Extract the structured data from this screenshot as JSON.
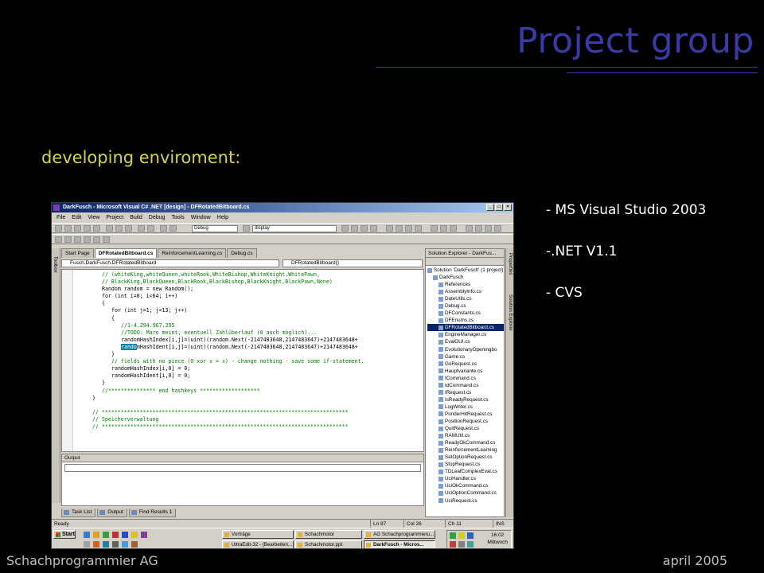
{
  "slide": {
    "title": "Project group",
    "subheading": "developing enviroment:",
    "bullets": [
      "- MS Visual Studio 2003",
      "-.NET V1.1",
      "- CVS"
    ],
    "footer_left": "Schachprogrammier AG",
    "footer_right": "april 2005",
    "colors": {
      "title": "#3a3aa6",
      "subheading": "#d4d44a",
      "background": "#000000"
    }
  },
  "vs": {
    "window_title": "DarkFusch - Microsoft Visual C# .NET [design] - DFRotatedBitboard.cs",
    "window_buttons": [
      "_",
      "□",
      "×"
    ],
    "menu": [
      "File",
      "Edit",
      "View",
      "Project",
      "Build",
      "Debug",
      "Tools",
      "Window",
      "Help"
    ],
    "toolbar": {
      "config": "Debug",
      "find": "display"
    },
    "toolbox_label": "Toolbox",
    "tabs": [
      "Start Page",
      "DFRotatedBitboard.cs",
      "ReinforcementLearning.cs",
      "Debug.cs"
    ],
    "nav": {
      "class_combo": "Fusch.DarkFusch.DFRotatedBitboard",
      "member_combo": "DFRotatedBitboard()"
    },
    "code": [
      {
        "text": "// (whiteKing,whiteQueen,whiteRook,WhiteBishop,WhiteKnight,WhitePawn,",
        "indent": 8,
        "kind": "comment"
      },
      {
        "text": "// BlackKing,BlackQueen,BlackRook,BlackBishop,BlackKnight,BlackPawn,None)",
        "indent": 8,
        "kind": "comment"
      },
      {
        "text": "Random random = new Random();",
        "indent": 8,
        "kind": "normal"
      },
      {
        "text": "for (int i=0; i<64; i++)",
        "indent": 8,
        "kind": "normal"
      },
      {
        "text": "{",
        "indent": 8,
        "kind": "normal"
      },
      {
        "text": "for (int j=1; j<13; j++)",
        "indent": 11,
        "kind": "normal"
      },
      {
        "text": "{",
        "indent": 11,
        "kind": "normal"
      },
      {
        "text": "//1-4.294.967.295",
        "indent": 14,
        "kind": "comment"
      },
      {
        "text": "//TODO: Maro meint, eventuell Zahlüberlauf (0 auch möglich)...",
        "indent": 14,
        "kind": "comment"
      },
      {
        "text": "randomHashIndex[i,j]=(uint)(random.Next(-2147483648,2147483647)+2147483648+",
        "indent": 14,
        "kind": "normal"
      },
      {
        "text": "randomHashIdent[i,j]=(uint)(random.Next(-2147483648,2147483647)+2147483648+",
        "indent": 14,
        "kind": "normal",
        "highlight": "rando"
      },
      {
        "text": "}",
        "indent": 11,
        "kind": "normal"
      },
      {
        "text": "// fields with no piece (0 xor x = x) - change nothing - save some if-statement.",
        "indent": 11,
        "kind": "comment"
      },
      {
        "text": "randomHashIndex[i,0] = 0;",
        "indent": 11,
        "kind": "normal"
      },
      {
        "text": "randomHashIdent[i,0] = 0;",
        "indent": 11,
        "kind": "normal"
      },
      {
        "text": "}",
        "indent": 8,
        "kind": "normal"
      },
      {
        "text": "//*************** end hashkeys *******************",
        "indent": 8,
        "kind": "comment"
      },
      {
        "text": "}",
        "indent": 5,
        "kind": "normal"
      },
      {
        "text": "",
        "indent": 0,
        "kind": "normal"
      },
      {
        "text": "// ******************************************************************************",
        "indent": 5,
        "kind": "comment"
      },
      {
        "text": "// Speicherverwaltung",
        "indent": 5,
        "kind": "comment"
      },
      {
        "text": "// ******************************************************************************",
        "indent": 5,
        "kind": "comment"
      }
    ],
    "output_label": "Output",
    "bottom_tabs": [
      "Task List",
      "Output",
      "Find Results 1"
    ],
    "solution": {
      "header": "Solution Explorer - DarkFus...",
      "items": [
        {
          "label": "Solution 'DarkFusch' (1 project)",
          "depth": 0
        },
        {
          "label": "DarkFusch",
          "depth": 1
        },
        {
          "label": "References",
          "depth": 2
        },
        {
          "label": "AssemblyInfo.cs",
          "depth": 2
        },
        {
          "label": "DateUtils.cs",
          "depth": 2
        },
        {
          "label": "Debug.cs",
          "depth": 2
        },
        {
          "label": "DFConstants.cs",
          "depth": 2
        },
        {
          "label": "DFEnums.cs",
          "depth": 2
        },
        {
          "label": "DFRotatedBitboard.cs",
          "depth": 2,
          "selected": true
        },
        {
          "label": "EngineManager.cs",
          "depth": 2
        },
        {
          "label": "EvalGUI.cs",
          "depth": 2
        },
        {
          "label": "EvolutionaryOpeningbo",
          "depth": 2
        },
        {
          "label": "Game.cs",
          "depth": 2
        },
        {
          "label": "GoRequest.cs",
          "depth": 2
        },
        {
          "label": "Hauptvariante.cs",
          "depth": 2
        },
        {
          "label": "ICommand.cs",
          "depth": 2
        },
        {
          "label": "IdCommand.cs",
          "depth": 2
        },
        {
          "label": "IRequest.cs",
          "depth": 2
        },
        {
          "label": "IsReadyRequest.cs",
          "depth": 2
        },
        {
          "label": "LogWriter.cs",
          "depth": 2
        },
        {
          "label": "PonderHitRequest.cs",
          "depth": 2
        },
        {
          "label": "PositionRequest.cs",
          "depth": 2
        },
        {
          "label": "QuitRequest.cs",
          "depth": 2
        },
        {
          "label": "RAMUtil.cs",
          "depth": 2
        },
        {
          "label": "ReadyOkCommand.cs",
          "depth": 2
        },
        {
          "label": "ReinforcementLearning",
          "depth": 2
        },
        {
          "label": "SetOptionRequest.cs",
          "depth": 2
        },
        {
          "label": "StopRequest.cs",
          "depth": 2
        },
        {
          "label": "TDLeafComplexEval.cs",
          "depth": 2
        },
        {
          "label": "UciHandler.cs",
          "depth": 2
        },
        {
          "label": "UciOkCommand.cs",
          "depth": 2
        },
        {
          "label": "UciOptionCommand.cs",
          "depth": 2
        },
        {
          "label": "UciRequest.cs",
          "depth": 2
        }
      ]
    },
    "right_strip": [
      "Properties",
      "Solution Explorer"
    ],
    "status": {
      "left": "Ready",
      "ln": "Ln 87",
      "col": "Col 26",
      "ch": "Ch 11",
      "ins": "INS"
    },
    "taskbar": {
      "start": "Start",
      "row1": [
        "Vorträge",
        "Schachmotor",
        "AG Schachprogrammieru..."
      ],
      "row2": [
        "UltraEdit-32 - [Bearbeiten...",
        "Schachmotor.ppt",
        "DarkFusch - Micros..."
      ],
      "time": "16:02",
      "day": "Mittwoch"
    }
  }
}
